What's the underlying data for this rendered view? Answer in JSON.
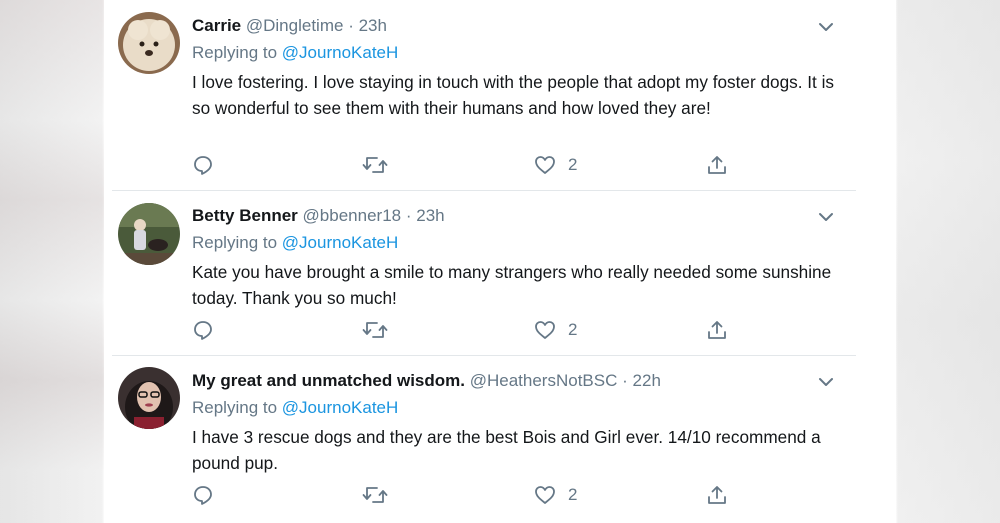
{
  "tweets": [
    {
      "name": "Carrie",
      "handle": "@Dingletime",
      "separator": "·",
      "time": "23h",
      "replying_prefix": "Replying to",
      "replying_to": "@JournoKateH",
      "text": "I love fostering. I love staying in touch with the people that adopt my foster dogs. It is so wonderful to see them with their humans and how loved they are!",
      "like_count": "2",
      "avatar_desc": "white-fluffy-dog"
    },
    {
      "name": "Betty Benner",
      "handle": "@bbenner18",
      "separator": "·",
      "time": "23h",
      "replying_prefix": "Replying to",
      "replying_to": "@JournoKateH",
      "text": "Kate you have brought a smile to many strangers who really needed some sunshine today. Thank you so much!",
      "like_count": "2",
      "avatar_desc": "person-with-dog-outdoors"
    },
    {
      "name": "My great and unmatched wisdom.",
      "handle": "@HeathersNotBSC",
      "separator": "·",
      "time": "22h",
      "replying_prefix": "Replying to",
      "replying_to": "@JournoKateH",
      "text": "I have 3 rescue dogs and they are the best Bois and Girl ever. 14/10 recommend a pound pup.",
      "like_count": "2",
      "avatar_desc": "woman-with-glasses"
    }
  ],
  "icons": {
    "reply": "reply-icon",
    "retweet": "retweet-icon",
    "like": "heart-icon",
    "share": "share-icon",
    "more": "chevron-down-icon"
  },
  "colors": {
    "text": "#14171a",
    "secondary": "#657786",
    "link": "#1b95e0",
    "divider": "#e3e7ea"
  }
}
